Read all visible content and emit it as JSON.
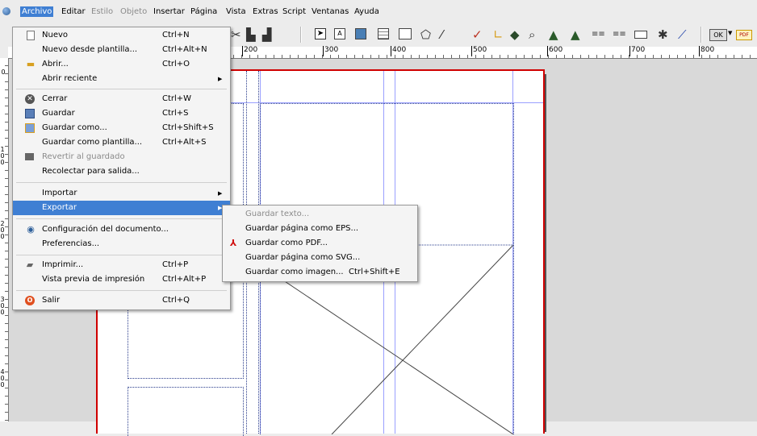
{
  "menubar": {
    "items": [
      "Archivo",
      "Editar",
      "Estilo",
      "Objeto",
      "Insertar",
      "Página",
      "Vista",
      "Extras",
      "Script",
      "Ventanas",
      "Ayuda"
    ]
  },
  "toolbar": {
    "ok_label": "OK",
    "pdf_label": "PDF"
  },
  "ruler": {
    "h_labels": [
      "200",
      "300",
      "400",
      "500",
      "600",
      "700",
      "800"
    ],
    "v_labels": [
      "0",
      "100",
      "200",
      "300",
      "400"
    ]
  },
  "archivo_menu": {
    "items": [
      {
        "label": "Nuevo",
        "shortcut": "Ctrl+N",
        "icon": "new-document-icon"
      },
      {
        "label": "Nuevo desde plantilla...",
        "shortcut": "Ctrl+Alt+N"
      },
      {
        "label": "Abrir...",
        "shortcut": "Ctrl+O",
        "icon": "folder-open-icon"
      },
      {
        "label": "Abrir reciente"
      },
      {
        "label": "Cerrar",
        "shortcut": "Ctrl+W",
        "icon": "close-icon"
      },
      {
        "label": "Guardar",
        "shortcut": "Ctrl+S",
        "icon": "save-icon"
      },
      {
        "label": "Guardar como...",
        "shortcut": "Ctrl+Shift+S",
        "icon": "save-as-icon"
      },
      {
        "label": "Guardar como plantilla...",
        "shortcut": "Ctrl+Alt+S"
      },
      {
        "label": "Revertir al guardado",
        "icon": "revert-icon"
      },
      {
        "label": "Recolectar para salida..."
      },
      {
        "label": "Importar"
      },
      {
        "label": "Exportar"
      },
      {
        "label": "Configuración del documento...",
        "icon": "document-settings-icon"
      },
      {
        "label": "Preferencias..."
      },
      {
        "label": "Imprimir...",
        "shortcut": "Ctrl+P",
        "icon": "printer-icon"
      },
      {
        "label": "Vista previa de impresión",
        "shortcut": "Ctrl+Alt+P"
      },
      {
        "label": "Salir",
        "shortcut": "Ctrl+Q",
        "icon": "quit-icon"
      }
    ]
  },
  "exportar_menu": {
    "items": [
      {
        "label": "Guardar texto..."
      },
      {
        "label": "Guardar página como EPS..."
      },
      {
        "label": "Guardar como PDF...",
        "icon": "pdf-icon"
      },
      {
        "label": "Guardar página como SVG..."
      },
      {
        "label": "Guardar como imagen...",
        "shortcut": "Ctrl+Shift+E"
      }
    ]
  },
  "colors": {
    "highlight": "#3f7fd3",
    "page_border": "#d00000",
    "guide": "#9aa0ff",
    "frame": "#2a3c8c"
  }
}
